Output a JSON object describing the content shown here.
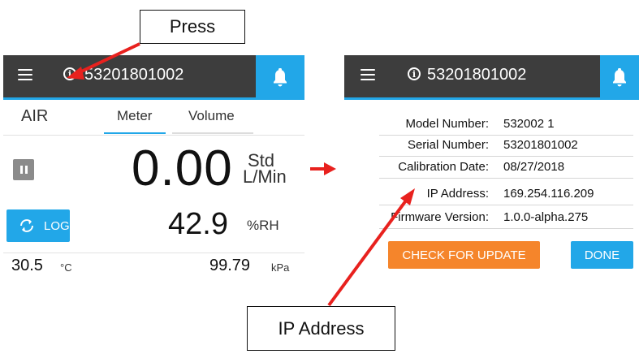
{
  "callouts": {
    "press": "Press",
    "ip_address": "IP Address"
  },
  "colors": {
    "accent": "#22a7e8",
    "header": "#3d3d3d",
    "update_button": "#f5852b",
    "annotation_arrow": "#e8211e"
  },
  "left_screen": {
    "header": {
      "menu_icon": "hamburger-menu-icon",
      "info_icon": "info-circle-icon",
      "serial": "53201801002",
      "bell_icon": "bell-icon"
    },
    "gas": "AIR",
    "tabs": [
      {
        "label": "Meter",
        "selected": true
      },
      {
        "label": "Volume",
        "selected": false
      }
    ],
    "pause_icon": "pause-icon",
    "flow_value": "0.00",
    "flow_unit_line1": "Std",
    "flow_unit_line2": "L/Min",
    "log_button": {
      "icon": "refresh-icon",
      "label": "LOG"
    },
    "humidity_value": "42.9",
    "humidity_unit": "%RH",
    "temperature_value": "30.5",
    "temperature_unit": "°C",
    "pressure_value": "99.79",
    "pressure_unit": "kPa"
  },
  "right_screen": {
    "header": {
      "menu_icon": "hamburger-menu-icon",
      "info_icon": "info-circle-icon",
      "serial": "53201801002",
      "bell_icon": "bell-icon"
    },
    "info_rows": [
      {
        "key": "Model Number:",
        "value": "532002 1"
      },
      {
        "key": "Serial Number:",
        "value": "53201801002"
      },
      {
        "key": "Calibration Date:",
        "value": "08/27/2018"
      },
      {
        "key": "IP Address:",
        "value": "169.254.116.209"
      },
      {
        "key": "Firmware Version:",
        "value": "1.0.0-alpha.275"
      }
    ],
    "check_update_label": "CHECK FOR UPDATE",
    "done_label": "DONE"
  }
}
